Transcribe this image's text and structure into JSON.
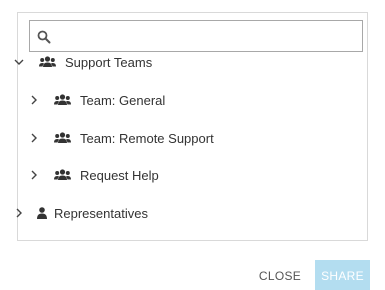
{
  "search": {
    "placeholder": "",
    "value": ""
  },
  "tree": {
    "support_teams": {
      "label": "Support Teams",
      "expanded": true,
      "icon": "group-icon"
    },
    "team_general": {
      "label": "Team: General",
      "expanded": false,
      "icon": "group-icon"
    },
    "team_remote": {
      "label": "Team: Remote Support",
      "expanded": false,
      "icon": "group-icon"
    },
    "request_help": {
      "label": "Request Help",
      "expanded": false,
      "icon": "group-icon"
    },
    "representatives": {
      "label": "Representatives",
      "expanded": false,
      "icon": "user-icon"
    }
  },
  "actions": {
    "close_label": "CLOSE",
    "share_label": "SHARE"
  },
  "colors": {
    "share_bg": "#b3ddf0",
    "border": "#d9d9d9",
    "text": "#333333"
  }
}
